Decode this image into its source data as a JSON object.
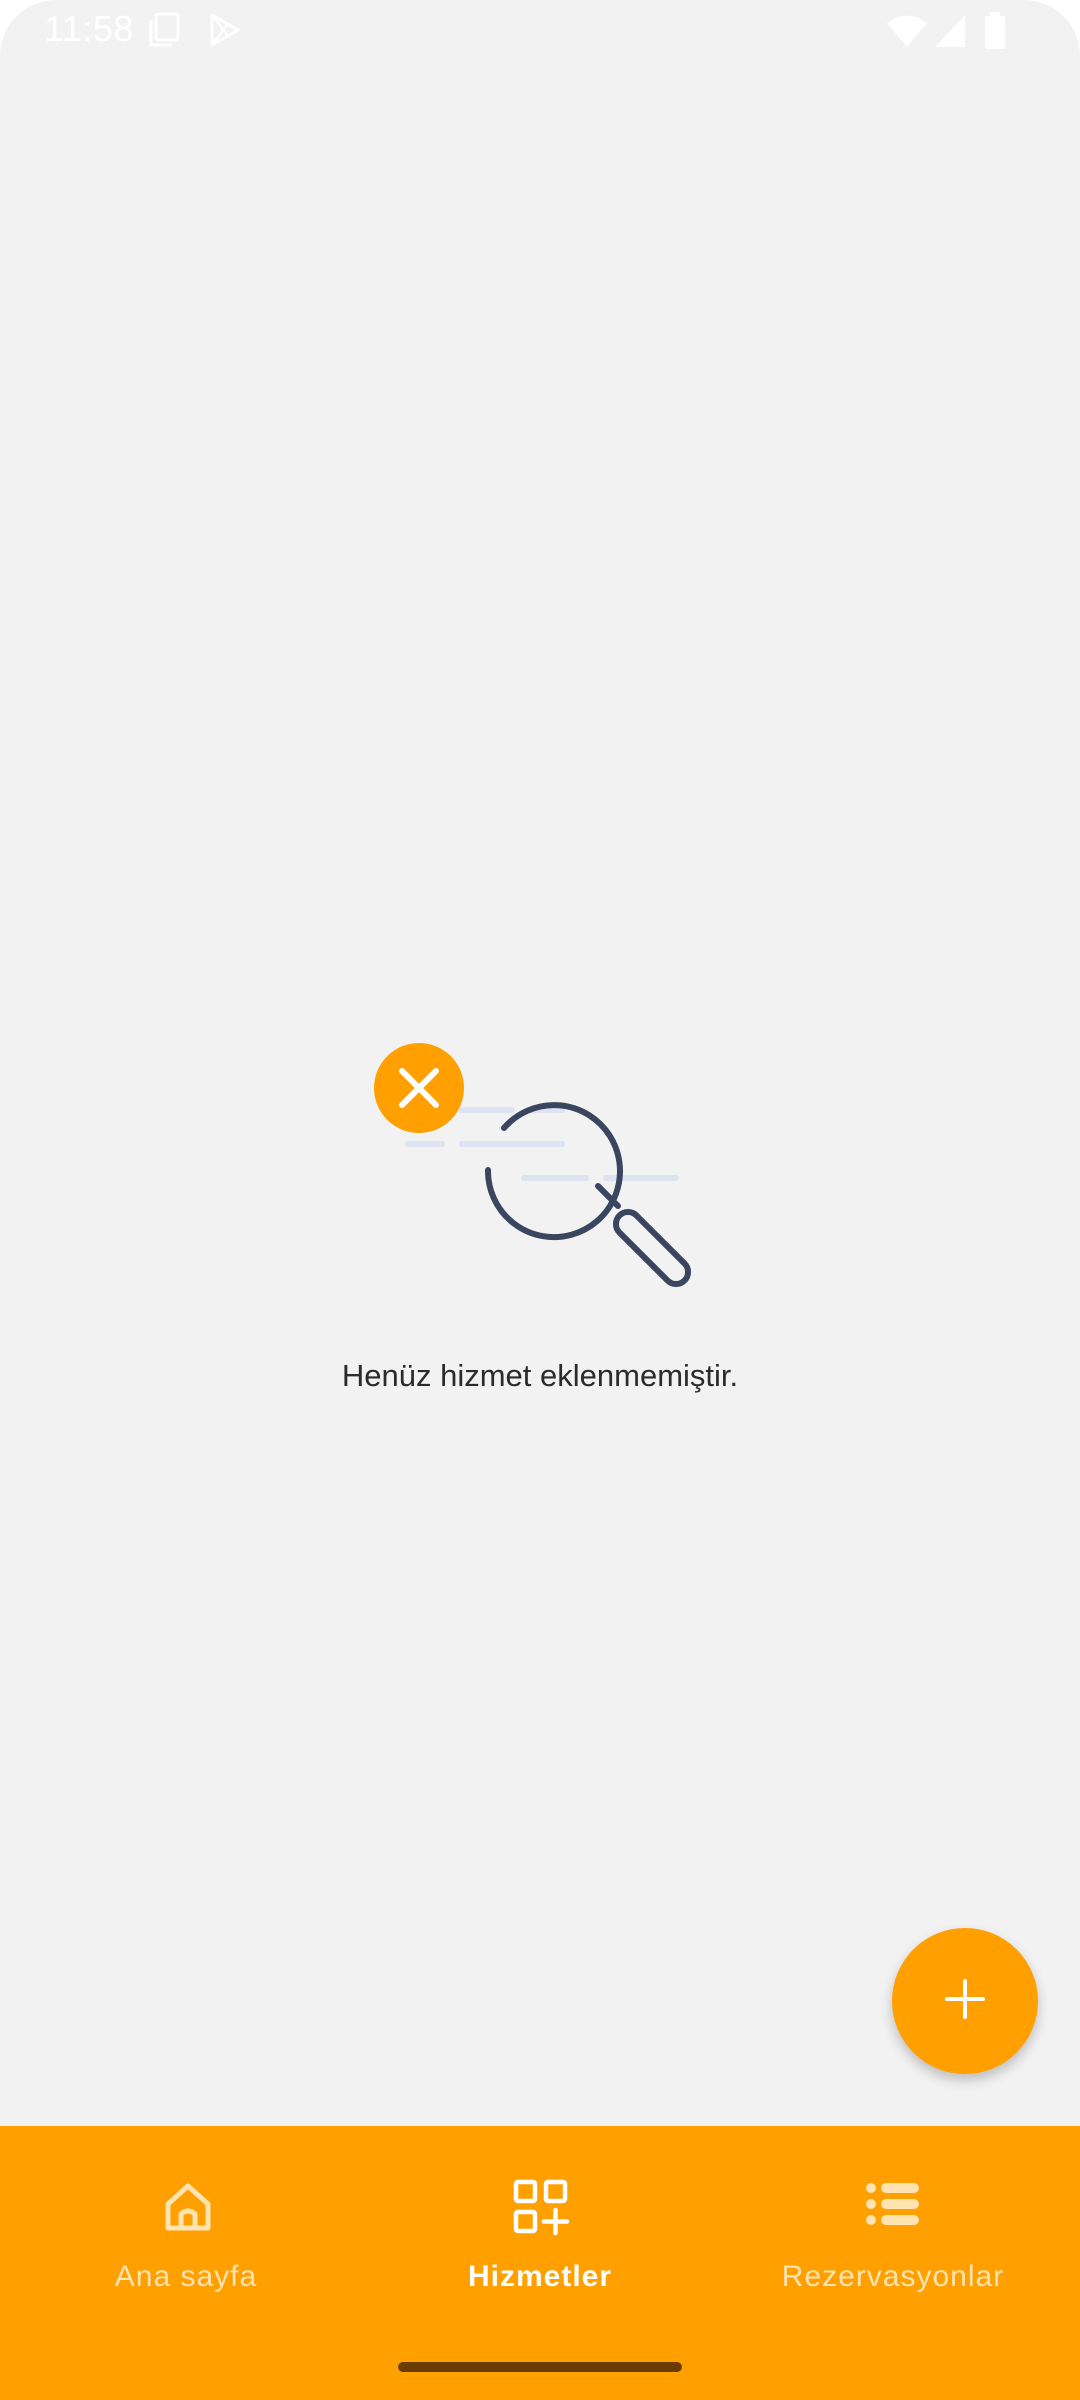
{
  "status_bar": {
    "time": "11:58",
    "icons": [
      "sim-card-icon",
      "play-store-icon",
      "wifi-icon",
      "signal-icon",
      "battery-icon"
    ]
  },
  "empty_state": {
    "illustration_icon": "search-not-found-icon",
    "message": "Henüz hizmet eklenmemiştir."
  },
  "fab": {
    "icon": "plus-icon"
  },
  "bottom_nav": {
    "items": [
      {
        "label": "Ana sayfa",
        "icon": "home-icon",
        "active": false
      },
      {
        "label": "Hizmetler",
        "icon": "grid-add-icon",
        "active": true
      },
      {
        "label": "Rezervasyonlar",
        "icon": "list-icon",
        "active": false
      }
    ]
  },
  "colors": {
    "accent": "#ffa000",
    "background": "#f2f2f2",
    "illustration_stroke": "#3a4660"
  }
}
